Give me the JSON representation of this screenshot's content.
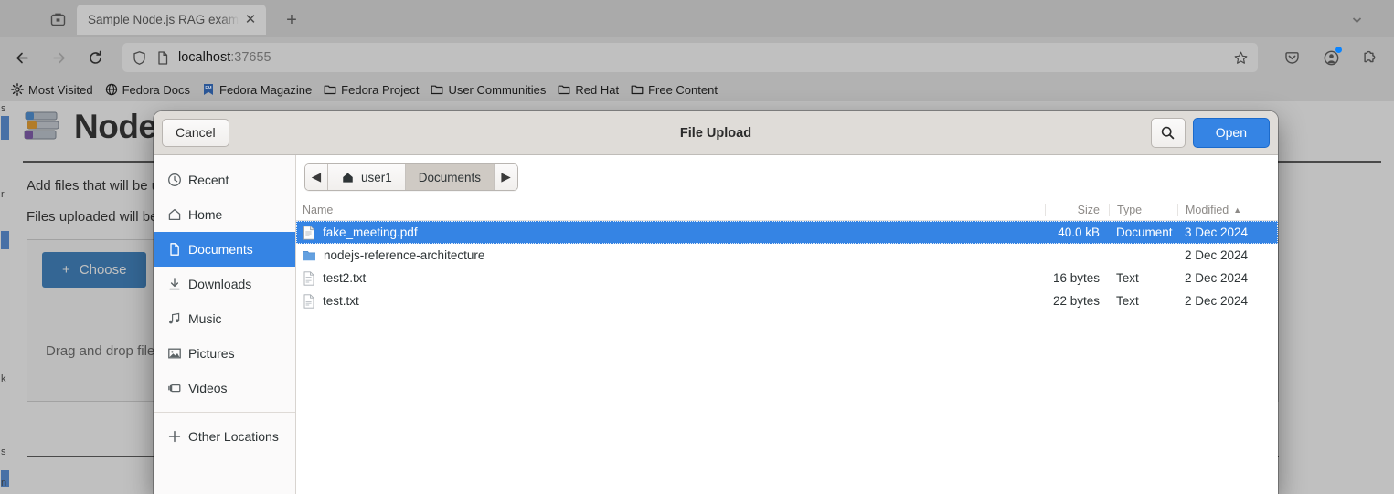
{
  "browser": {
    "tab": {
      "title": "Sample Node.js RAG example",
      "close_label": "✕"
    },
    "new_tab_label": "+",
    "url": {
      "host": "localhost",
      "port": ":37655"
    },
    "bookmarks": [
      {
        "label": "Most Visited",
        "icon": "gear-icon"
      },
      {
        "label": "Fedora Docs",
        "icon": "globe-icon"
      },
      {
        "label": "Fedora Magazine",
        "icon": "fm-bookmark-icon"
      },
      {
        "label": "Fedora Project",
        "icon": "folder-icon"
      },
      {
        "label": "User Communities",
        "icon": "folder-icon"
      },
      {
        "label": "Red Hat",
        "icon": "folder-icon"
      },
      {
        "label": "Free Content",
        "icon": "folder-icon"
      }
    ]
  },
  "page": {
    "title": "Node.js",
    "intro_line1": "Add files that will be u",
    "intro_line2": "Files uploaded will be",
    "choose_label": "Choose",
    "choose_plus": "+",
    "dropzone_text": "Drag and drop files"
  },
  "dialog": {
    "title": "File Upload",
    "cancel_label": "Cancel",
    "open_label": "Open",
    "search_icon": "search-icon",
    "places": [
      {
        "label": "Recent",
        "icon": "clock-icon",
        "active": false
      },
      {
        "label": "Home",
        "icon": "home-icon",
        "active": false
      },
      {
        "label": "Documents",
        "icon": "document-icon",
        "active": true
      },
      {
        "label": "Downloads",
        "icon": "download-icon",
        "active": false
      },
      {
        "label": "Music",
        "icon": "music-icon",
        "active": false
      },
      {
        "label": "Pictures",
        "icon": "picture-icon",
        "active": false
      },
      {
        "label": "Videos",
        "icon": "video-icon",
        "active": false
      }
    ],
    "other_locations": {
      "label": "Other Locations",
      "icon": "plus-icon"
    },
    "path": {
      "back_glyph": "◀",
      "forward_glyph": "▶",
      "crumbs": [
        {
          "label": "user1",
          "icon": "home-icon",
          "current": false
        },
        {
          "label": "Documents",
          "icon": "",
          "current": true
        }
      ]
    },
    "columns": {
      "name": "Name",
      "size": "Size",
      "type": "Type",
      "modified": "Modified",
      "sort_glyph": "▲"
    },
    "files": [
      {
        "name": "fake_meeting.pdf",
        "size": "40.0 kB",
        "type": "Document",
        "modified": "3 Dec 2024",
        "icon": "pdf-file-icon",
        "selected": true
      },
      {
        "name": "nodejs-reference-architecture",
        "size": "",
        "type": "",
        "modified": "2 Dec 2024",
        "icon": "folder-icon",
        "selected": false
      },
      {
        "name": "test2.txt",
        "size": "16 bytes",
        "type": "Text",
        "modified": "2 Dec 2024",
        "icon": "text-file-icon",
        "selected": false
      },
      {
        "name": "test.txt",
        "size": "22 bytes",
        "type": "Text",
        "modified": "2 Dec 2024",
        "icon": "text-file-icon",
        "selected": false
      }
    ]
  },
  "colors": {
    "accent": "#3584e4",
    "page_button": "#1d6fb8",
    "chrome": "#b2b2b2",
    "dialog_header": "#dfdcd8"
  }
}
